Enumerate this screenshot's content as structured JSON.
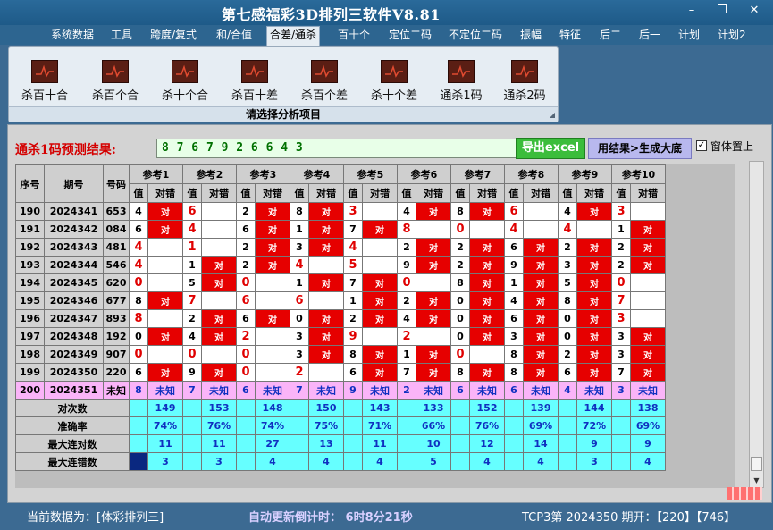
{
  "app": {
    "title": "第七感福彩3D排列三软件V8.81",
    "window_controls": [
      "minimize",
      "maximize",
      "close"
    ]
  },
  "menu": [
    "系统数据",
    "工具",
    "跨度/复式",
    "和/合值",
    "合差/通杀",
    "百十个",
    "定位二码",
    "不定位二码",
    "振幅",
    "特征",
    "后二",
    "后一",
    "计划",
    "计划2"
  ],
  "menu_active": "合差/通杀",
  "ribbon": {
    "buttons": [
      "杀百十合",
      "杀百个合",
      "杀十个合",
      "杀百十差",
      "杀百个差",
      "杀十个差",
      "通杀1码",
      "通杀2码"
    ],
    "caption": "请选择分析项目"
  },
  "prediction": {
    "label": "通杀1码预测结果:",
    "value": "8 7 6 7 9 2 6 6 4 3",
    "export_button": "导出excel",
    "generate_button": "用结果>生成大底",
    "topmost_label": "窗体置上",
    "topmost_checked": true
  },
  "table": {
    "col_seq": "序号",
    "col_period": "期号",
    "col_number": "号码",
    "ref_headers": [
      "参考1",
      "参考2",
      "参考3",
      "参考4",
      "参考5",
      "参考6",
      "参考7",
      "参考8",
      "参考9",
      "参考10"
    ],
    "sub_value": "值",
    "sub_result": "对错",
    "ok_text": "对",
    "rows": [
      {
        "seq": "190",
        "period": "2024341",
        "number": "653",
        "vals": [
          "4",
          "6",
          "2",
          "8",
          "3",
          "4",
          "8",
          "6",
          "4",
          "3"
        ],
        "reds": [
          0,
          1,
          0,
          0,
          1,
          0,
          0,
          1,
          0,
          1
        ],
        "oks": [
          1,
          0,
          1,
          1,
          0,
          1,
          1,
          0,
          1,
          0
        ]
      },
      {
        "seq": "191",
        "period": "2024342",
        "number": "084",
        "vals": [
          "6",
          "4",
          "6",
          "1",
          "7",
          "8",
          "0",
          "4",
          "4",
          "1"
        ],
        "reds": [
          0,
          1,
          0,
          0,
          0,
          1,
          1,
          1,
          1,
          0
        ],
        "oks": [
          1,
          0,
          1,
          1,
          1,
          0,
          0,
          0,
          0,
          1
        ]
      },
      {
        "seq": "192",
        "period": "2024343",
        "number": "481",
        "vals": [
          "4",
          "1",
          "2",
          "3",
          "4",
          "2",
          "2",
          "6",
          "2",
          "2"
        ],
        "reds": [
          1,
          1,
          0,
          0,
          1,
          0,
          0,
          0,
          0,
          0
        ],
        "oks": [
          0,
          0,
          1,
          1,
          0,
          1,
          1,
          1,
          1,
          1
        ]
      },
      {
        "seq": "193",
        "period": "2024344",
        "number": "546",
        "vals": [
          "4",
          "1",
          "2",
          "4",
          "5",
          "9",
          "2",
          "9",
          "3",
          "2"
        ],
        "reds": [
          1,
          0,
          0,
          1,
          1,
          0,
          0,
          0,
          0,
          0
        ],
        "oks": [
          0,
          1,
          1,
          0,
          0,
          1,
          1,
          1,
          1,
          1
        ]
      },
      {
        "seq": "194",
        "period": "2024345",
        "number": "620",
        "vals": [
          "0",
          "5",
          "0",
          "1",
          "7",
          "0",
          "8",
          "1",
          "5",
          "0"
        ],
        "reds": [
          1,
          0,
          1,
          0,
          0,
          1,
          0,
          0,
          0,
          1
        ],
        "oks": [
          0,
          1,
          0,
          1,
          1,
          0,
          1,
          1,
          1,
          0
        ]
      },
      {
        "seq": "195",
        "period": "2024346",
        "number": "677",
        "vals": [
          "8",
          "7",
          "6",
          "6",
          "1",
          "2",
          "0",
          "4",
          "8",
          "7"
        ],
        "reds": [
          0,
          1,
          1,
          1,
          0,
          0,
          0,
          0,
          0,
          1
        ],
        "oks": [
          1,
          0,
          0,
          0,
          1,
          1,
          1,
          1,
          1,
          0
        ]
      },
      {
        "seq": "196",
        "period": "2024347",
        "number": "893",
        "vals": [
          "8",
          "2",
          "6",
          "0",
          "2",
          "4",
          "0",
          "6",
          "0",
          "3"
        ],
        "reds": [
          1,
          0,
          0,
          0,
          0,
          0,
          0,
          0,
          0,
          1
        ],
        "oks": [
          0,
          1,
          1,
          1,
          1,
          1,
          1,
          1,
          1,
          0
        ]
      },
      {
        "seq": "197",
        "period": "2024348",
        "number": "192",
        "vals": [
          "0",
          "4",
          "2",
          "3",
          "9",
          "2",
          "0",
          "3",
          "0",
          "3"
        ],
        "reds": [
          0,
          0,
          1,
          0,
          1,
          1,
          0,
          0,
          0,
          0
        ],
        "oks": [
          1,
          1,
          0,
          1,
          0,
          0,
          1,
          1,
          1,
          1
        ]
      },
      {
        "seq": "198",
        "period": "2024349",
        "number": "907",
        "vals": [
          "0",
          "0",
          "0",
          "3",
          "8",
          "1",
          "0",
          "8",
          "2",
          "3"
        ],
        "reds": [
          1,
          1,
          1,
          0,
          0,
          0,
          1,
          0,
          0,
          0
        ],
        "oks": [
          0,
          0,
          0,
          1,
          1,
          1,
          0,
          1,
          1,
          1
        ]
      },
      {
        "seq": "199",
        "period": "2024350",
        "number": "220",
        "vals": [
          "6",
          "9",
          "0",
          "2",
          "6",
          "7",
          "8",
          "8",
          "6",
          "7"
        ],
        "reds": [
          0,
          0,
          1,
          1,
          0,
          0,
          0,
          0,
          0,
          0
        ],
        "oks": [
          1,
          1,
          0,
          0,
          1,
          1,
          1,
          1,
          1,
          1
        ]
      }
    ],
    "predict_row": {
      "seq": "200",
      "period": "2024351",
      "number": "未知",
      "vals": [
        "8",
        "7",
        "6",
        "7",
        "9",
        "2",
        "6",
        "6",
        "4",
        "3"
      ],
      "result": "未知"
    },
    "stats": [
      {
        "label": "对次数",
        "values": [
          "149",
          "153",
          "148",
          "150",
          "143",
          "133",
          "152",
          "139",
          "144",
          "138"
        ]
      },
      {
        "label": "准确率",
        "values": [
          "74%",
          "76%",
          "74%",
          "75%",
          "71%",
          "66%",
          "76%",
          "69%",
          "72%",
          "69%"
        ]
      },
      {
        "label": "最大连对数",
        "values": [
          "11",
          "11",
          "27",
          "13",
          "11",
          "10",
          "12",
          "14",
          "9",
          "9"
        ]
      },
      {
        "label": "最大连错数",
        "values": [
          "3",
          "3",
          "4",
          "4",
          "4",
          "5",
          "4",
          "4",
          "3",
          "4"
        ]
      }
    ]
  },
  "status": {
    "current_data": "当前数据为：[体彩排列三]",
    "countdown": "自动更新倒计时： 6时8分21秒",
    "draw_info": "TCP3第 2024350 期开：【220】【746】"
  },
  "colors": {
    "ok_red": "#e60000",
    "stat_cyan": "#66ffff",
    "predict_pink": "#fab4f8",
    "pred_label_red": "#d40000",
    "pred_value_green": "#007000",
    "export_green": "#3bbd3b"
  }
}
